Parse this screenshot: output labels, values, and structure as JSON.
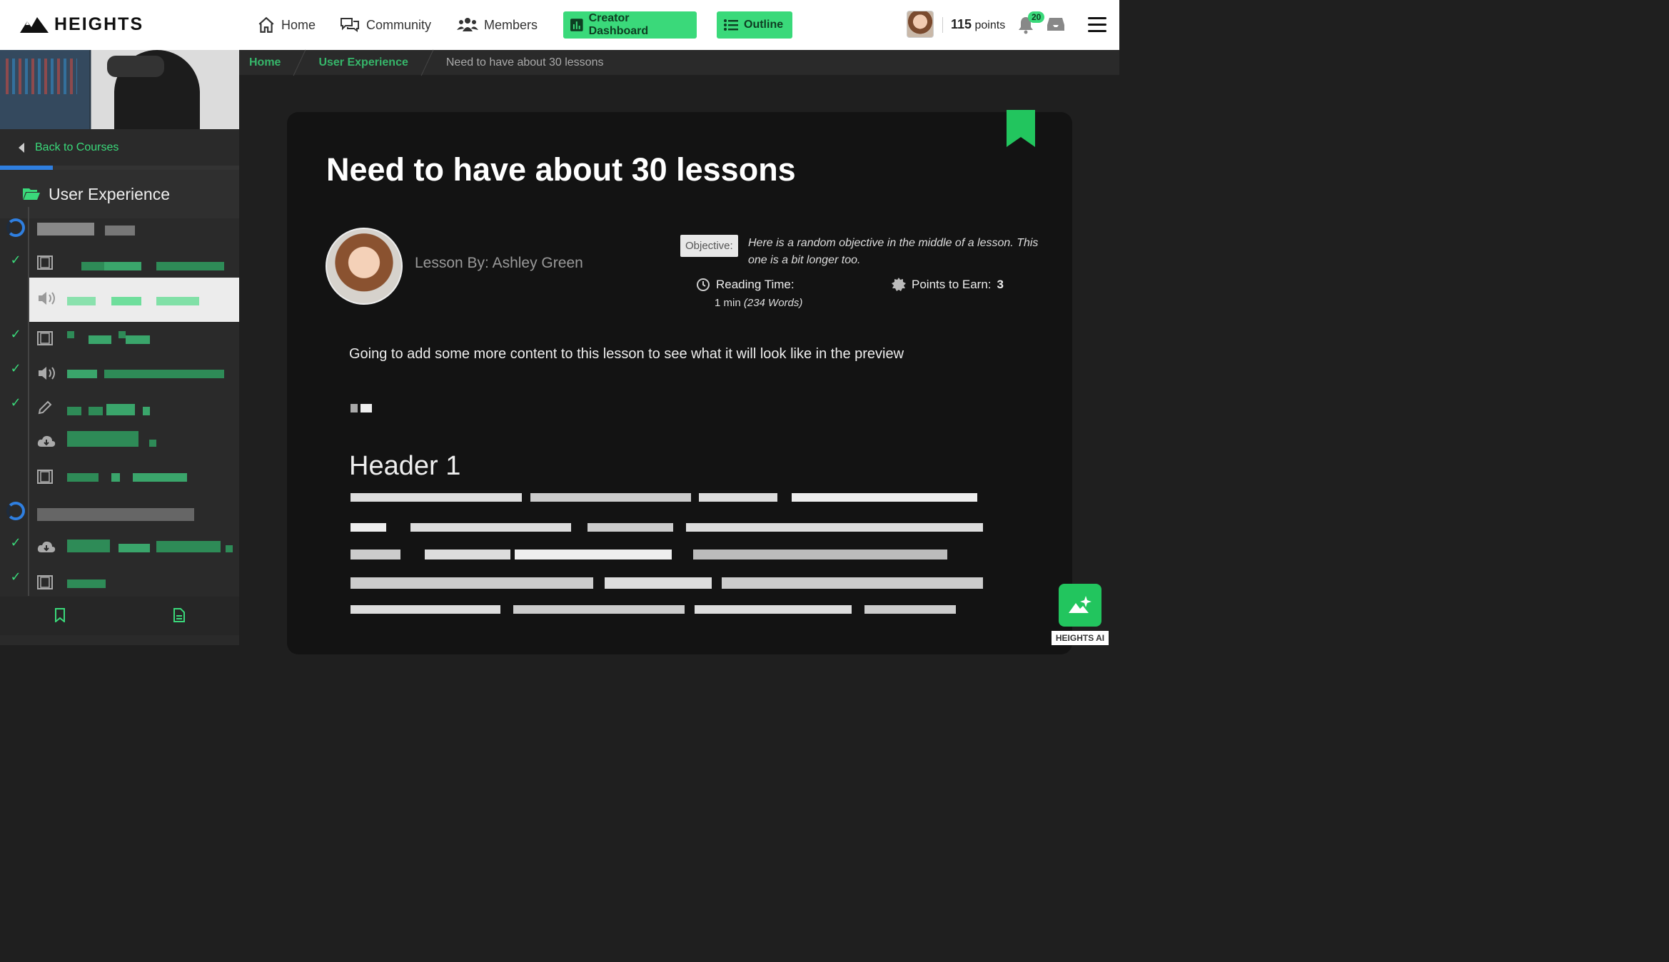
{
  "nav": {
    "brand": "HEIGHTS",
    "home": "Home",
    "community": "Community",
    "members": "Members",
    "creator_dashboard": "Creator Dashboard",
    "outline": "Outline",
    "points_value": "115",
    "points_unit": "points",
    "notifications": "20"
  },
  "sidebar": {
    "back": "Back to Courses",
    "course_title": "User Experience",
    "progress_percent": 22
  },
  "breadcrumb": {
    "home": "Home",
    "course": "User Experience",
    "current": "Need to have about 30 lessons"
  },
  "lesson": {
    "title": "Need to have about 30 lessons",
    "author": "Lesson By: Ashley Green",
    "objective_label": "Objective:",
    "objective_text": "Here is a random objective in the middle of a lesson. This one is a bit longer too.",
    "reading_label": "Reading Time:",
    "reading_value": "1 min",
    "reading_words": "(234 Words)",
    "points_label": "Points to Earn:",
    "points_value": "3",
    "intro": "Going to add some more content to this lesson to see what it will look like in the preview",
    "header1": "Header 1"
  },
  "ai": {
    "label": "HEIGHTS AI"
  },
  "colors": {
    "accent": "#3ad97a",
    "progress": "#2f7fe0",
    "card": "#131313"
  }
}
